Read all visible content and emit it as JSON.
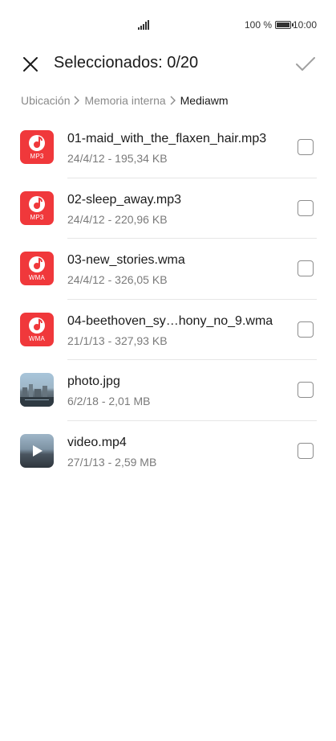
{
  "status_bar": {
    "battery_text": "100 %",
    "time": "10:00"
  },
  "header": {
    "title": "Seleccionados: 0/20"
  },
  "breadcrumb": [
    {
      "label": "Ubicación"
    },
    {
      "label": "Memoria interna"
    },
    {
      "label": "Mediawm"
    }
  ],
  "files": [
    {
      "name": "01-maid_with_the_flaxen_hair.mp3",
      "meta": "24/4/12 - 195,34 KB",
      "thumb_label": "MP3"
    },
    {
      "name": "02-sleep_away.mp3",
      "meta": "24/4/12 - 220,96 KB",
      "thumb_label": "MP3"
    },
    {
      "name": "03-new_stories.wma",
      "meta": "24/4/12 - 326,05 KB",
      "thumb_label": "WMA"
    },
    {
      "name": "04-beethoven_sy…hony_no_9.wma",
      "meta": "21/1/13 - 327,93 KB",
      "thumb_label": "WMA"
    },
    {
      "name": "photo.jpg",
      "meta": "6/2/18 - 2,01 MB"
    },
    {
      "name": "video.mp4",
      "meta": "27/1/13 - 2,59 MB"
    }
  ],
  "colors": {
    "audio_accent": "#f0383b"
  }
}
